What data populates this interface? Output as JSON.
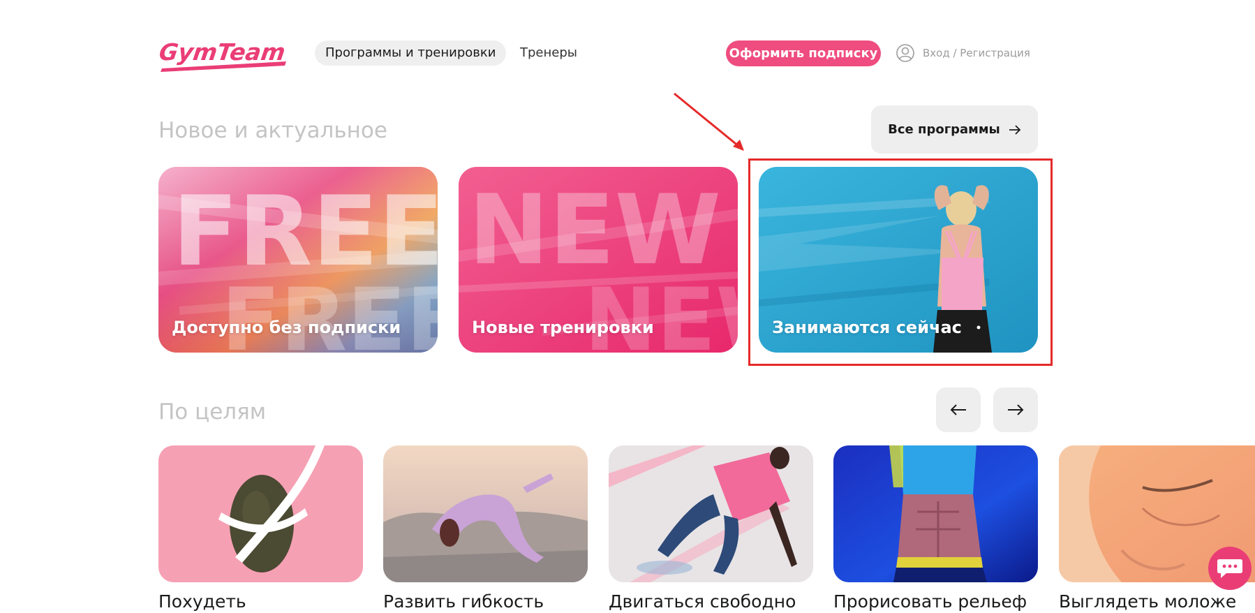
{
  "header": {
    "logo_text": "GymTeam",
    "nav_programs": "Программы и тренировки",
    "nav_trainers": "Тренеры",
    "subscribe_button": "Оформить подписку",
    "login_link": "Вход / Регистрация"
  },
  "new_section": {
    "title": "Новое и актуальное",
    "all_programs_button": "Все программы",
    "cards": [
      {
        "label": "Доступно без подписки",
        "background_word": "FREE"
      },
      {
        "label": "Новые тренировки",
        "background_word": "NEW"
      },
      {
        "label": "Занимаются сейчас"
      }
    ]
  },
  "goals_section": {
    "title": "По целям",
    "cards": [
      {
        "label": "Похудеть"
      },
      {
        "label": "Развить гибкость"
      },
      {
        "label": "Двигаться свободно"
      },
      {
        "label": "Прорисовать рельеф"
      },
      {
        "label": "Выглядеть моложе"
      }
    ]
  },
  "colors": {
    "brand_pink": "#ef4c7f",
    "annotation_red": "#e52a2a",
    "button_gray": "#eeeeee",
    "section_title_gray": "#c4c4c4",
    "teal_card": "#2fa8d4"
  },
  "icons": {
    "user": "user-circle-icon",
    "arrow_right": "arrow-right-icon",
    "arrow_left": "arrow-left-icon",
    "chat": "chat-bubble-icon"
  }
}
